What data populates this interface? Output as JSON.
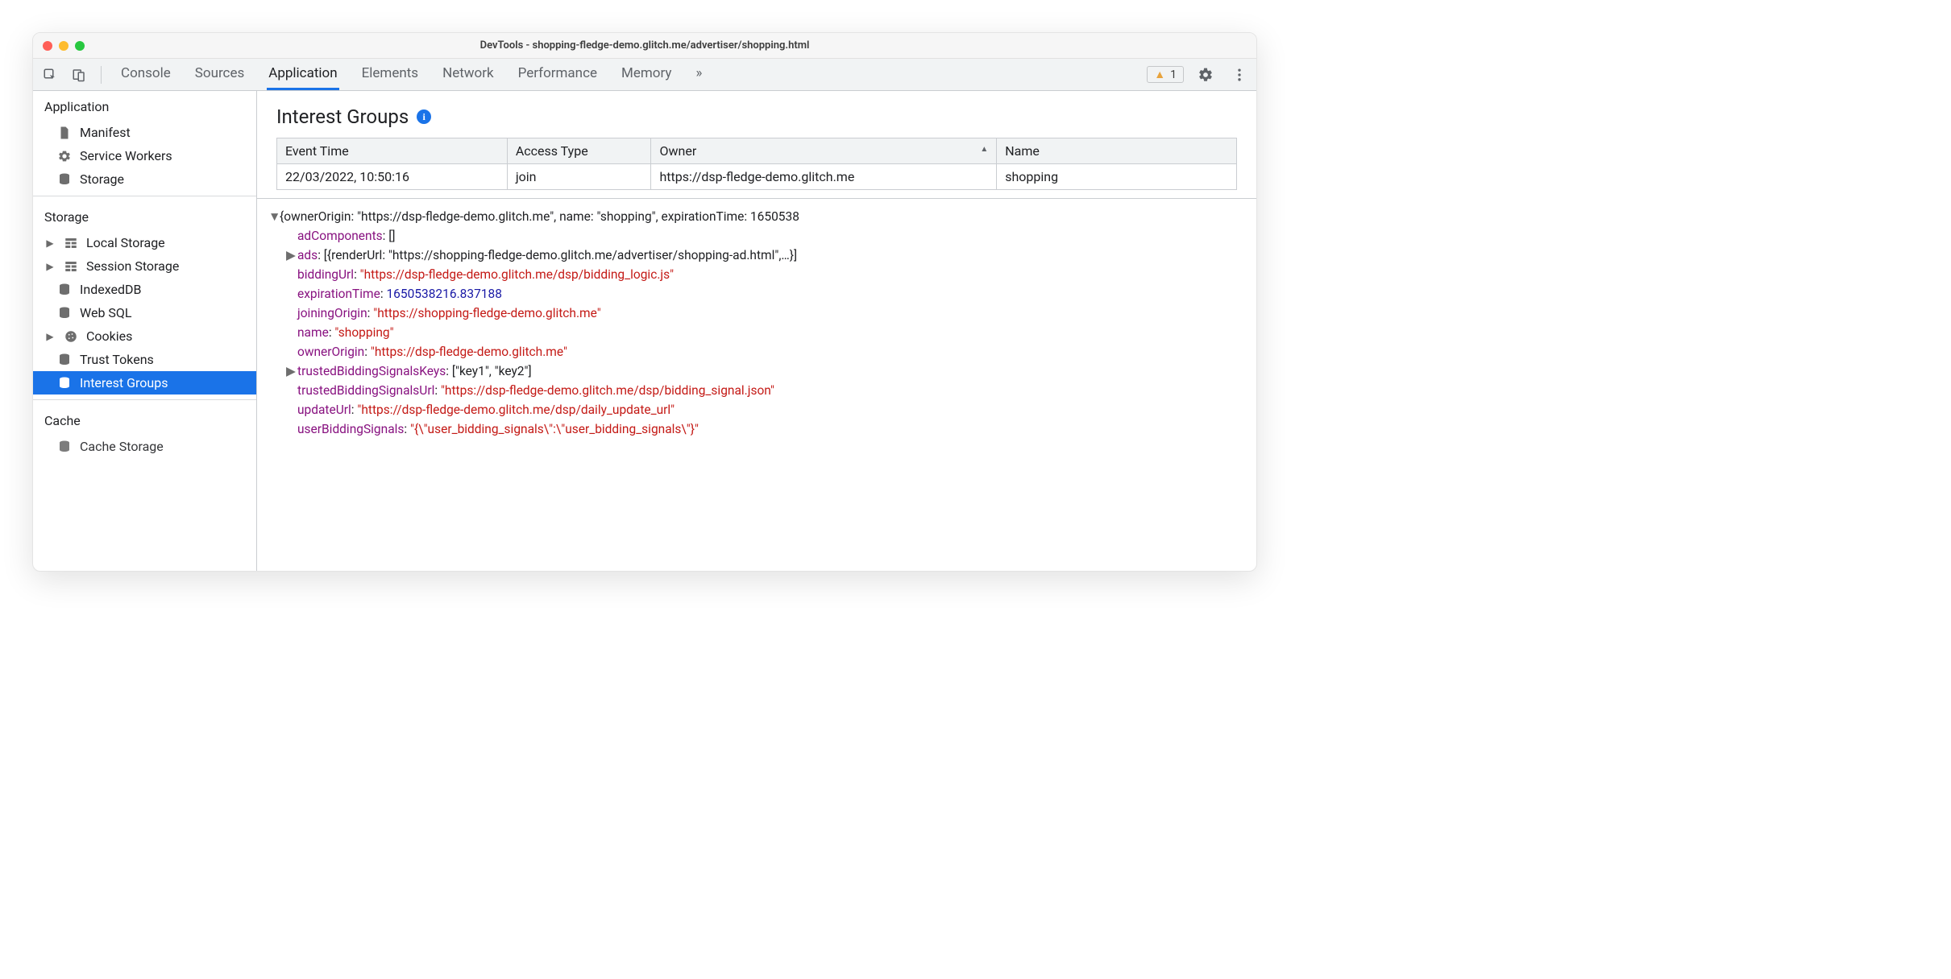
{
  "window_title": "DevTools - shopping-fledge-demo.glitch.me/advertiser/shopping.html",
  "warning_count": "1",
  "tabs": [
    "Console",
    "Sources",
    "Application",
    "Elements",
    "Network",
    "Performance",
    "Memory"
  ],
  "active_tab": "Application",
  "sidebar": {
    "sections": {
      "application": {
        "title": "Application",
        "items": [
          "Manifest",
          "Service Workers",
          "Storage"
        ]
      },
      "storage": {
        "title": "Storage",
        "items": [
          "Local Storage",
          "Session Storage",
          "IndexedDB",
          "Web SQL",
          "Cookies",
          "Trust Tokens",
          "Interest Groups"
        ]
      },
      "cache": {
        "title": "Cache",
        "items": [
          "Cache Storage"
        ]
      }
    },
    "selected": "Interest Groups"
  },
  "panel_title": "Interest Groups",
  "table": {
    "headers": [
      "Event Time",
      "Access Type",
      "Owner",
      "Name"
    ],
    "sort_col": "Owner",
    "rows": [
      {
        "event_time": "22/03/2022, 10:50:16",
        "access_type": "join",
        "owner": "https://dsp-fledge-demo.glitch.me",
        "name": "shopping"
      }
    ]
  },
  "object": {
    "root_summary": "{ownerOrigin: \"https://dsp-fledge-demo.glitch.me\", name: \"shopping\", expirationTime: 1650538",
    "adComponents_label": "adComponents",
    "adComponents_value": "[]",
    "ads_label": "ads",
    "ads_value": "[{renderUrl: \"https://shopping-fledge-demo.glitch.me/advertiser/shopping-ad.html\",…}]",
    "biddingUrl_label": "biddingUrl",
    "biddingUrl_value": "\"https://dsp-fledge-demo.glitch.me/dsp/bidding_logic.js\"",
    "expirationTime_label": "expirationTime",
    "expirationTime_value": "1650538216.837188",
    "joiningOrigin_label": "joiningOrigin",
    "joiningOrigin_value": "\"https://shopping-fledge-demo.glitch.me\"",
    "name_label": "name",
    "name_value": "\"shopping\"",
    "ownerOrigin_label": "ownerOrigin",
    "ownerOrigin_value": "\"https://dsp-fledge-demo.glitch.me\"",
    "tbsk_label": "trustedBiddingSignalsKeys",
    "tbsk_value": "[\"key1\", \"key2\"]",
    "tbsu_label": "trustedBiddingSignalsUrl",
    "tbsu_value": "\"https://dsp-fledge-demo.glitch.me/dsp/bidding_signal.json\"",
    "updateUrl_label": "updateUrl",
    "updateUrl_value": "\"https://dsp-fledge-demo.glitch.me/dsp/daily_update_url\"",
    "userBiddingSignals_label": "userBiddingSignals",
    "userBiddingSignals_value": "\"{\\\"user_bidding_signals\\\":\\\"user_bidding_signals\\\"}\""
  }
}
